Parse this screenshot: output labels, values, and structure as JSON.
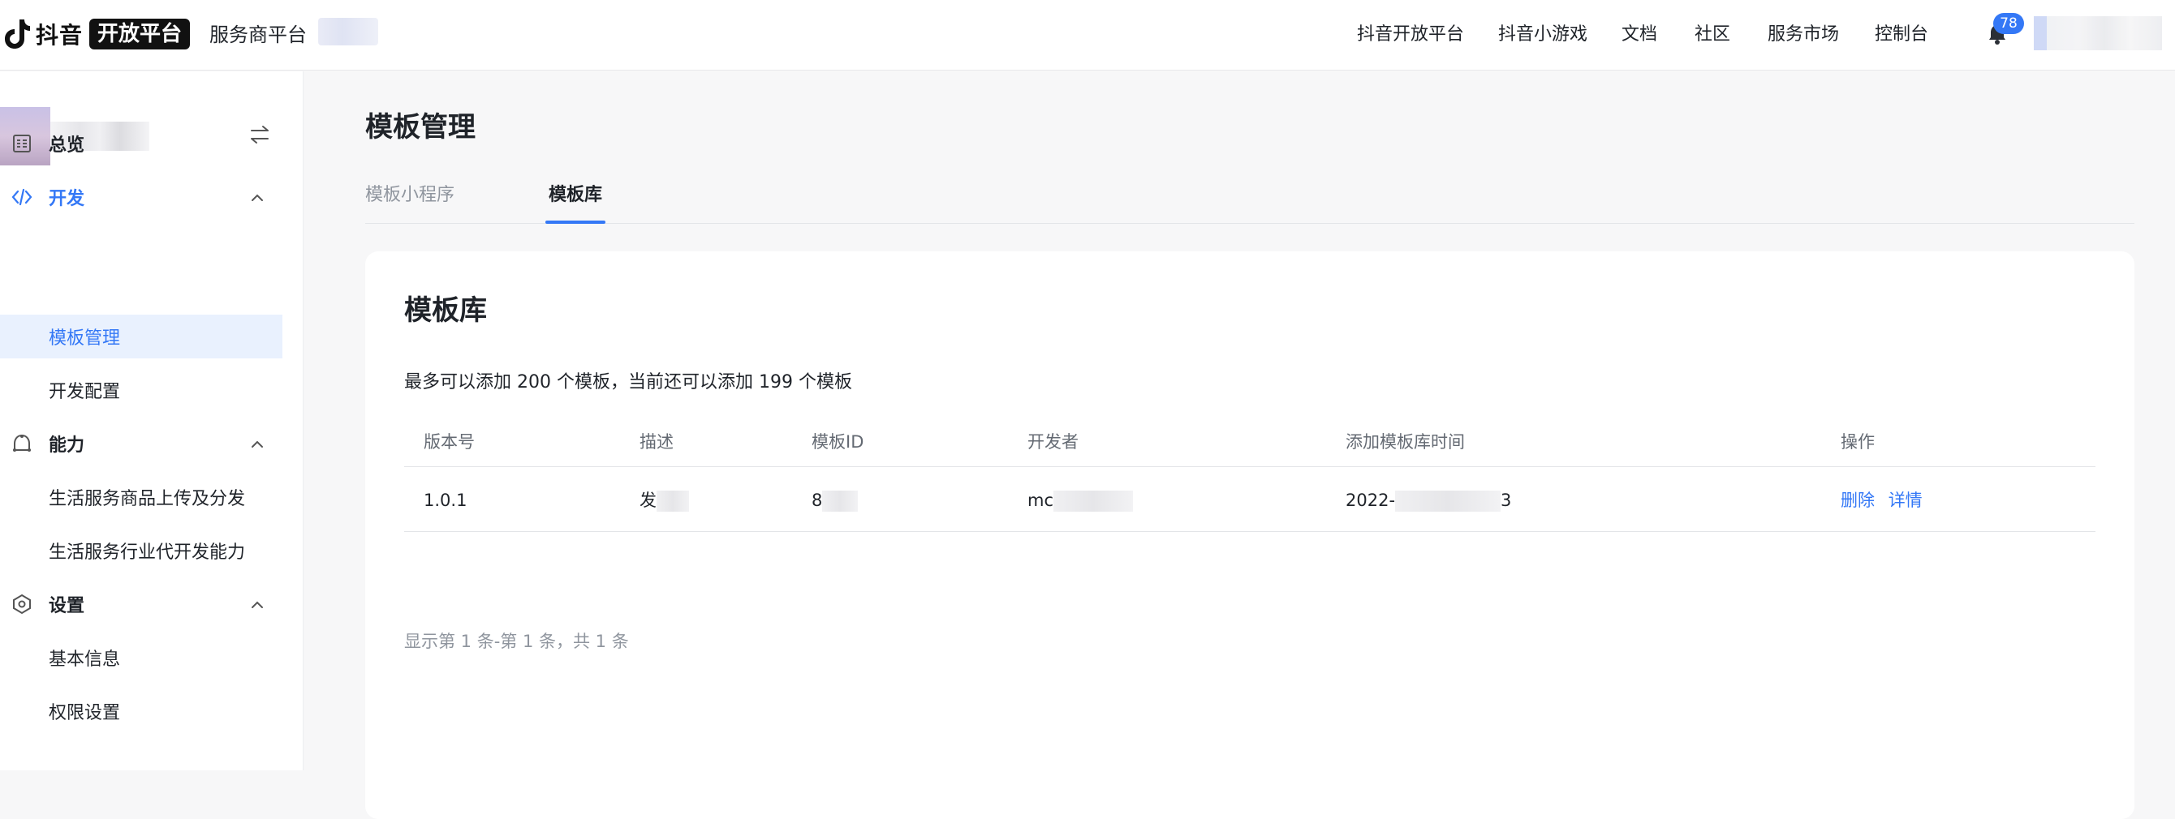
{
  "header": {
    "brand": "抖音",
    "brand_badge": "开放平台",
    "subtitle": "服务商平台",
    "nav": [
      "抖音开放平台",
      "抖音小游戏",
      "文档",
      "社区",
      "服务市场",
      "控制台"
    ],
    "notification_count": "78"
  },
  "sidebar": {
    "groups": [
      {
        "label": "总览",
        "icon": "overview-icon",
        "expanded": false
      },
      {
        "label": "开发",
        "icon": "code-icon",
        "expanded": true
      },
      {
        "label": "能力",
        "icon": "ability-icon",
        "expanded": true
      },
      {
        "label": "设置",
        "icon": "settings-icon",
        "expanded": true
      }
    ],
    "sub_items": {
      "dev": [
        "模板管理",
        "开发配置"
      ],
      "ability": [
        "生活服务商品上传及分发",
        "生活服务行业代开发能力"
      ],
      "settings": [
        "基本信息",
        "权限设置"
      ]
    },
    "active_item": "模板管理"
  },
  "main": {
    "page_title": "模板管理",
    "tabs": [
      {
        "label": "模板小程序",
        "active": false
      },
      {
        "label": "模板库",
        "active": true
      }
    ],
    "card": {
      "title": "模板库",
      "description": "最多可以添加 200 个模板，当前还可以添加 199 个模板",
      "columns": [
        "版本号",
        "描述",
        "模板ID",
        "开发者",
        "添加模板库时间",
        "操作"
      ],
      "rows": [
        {
          "version": "1.0.1",
          "desc_prefix": "发",
          "template_id_prefix": "8",
          "developer_prefix": "mc",
          "added_time_prefix": "2022-",
          "added_time_suffix": "3",
          "actions": [
            "删除",
            "详情"
          ]
        }
      ],
      "pagination": "显示第 1 条-第 1 条，共 1 条"
    }
  },
  "colors": {
    "accent": "#3478f6",
    "active_bg": "#e9f1fe",
    "page_bg": "#f7f7f8"
  }
}
